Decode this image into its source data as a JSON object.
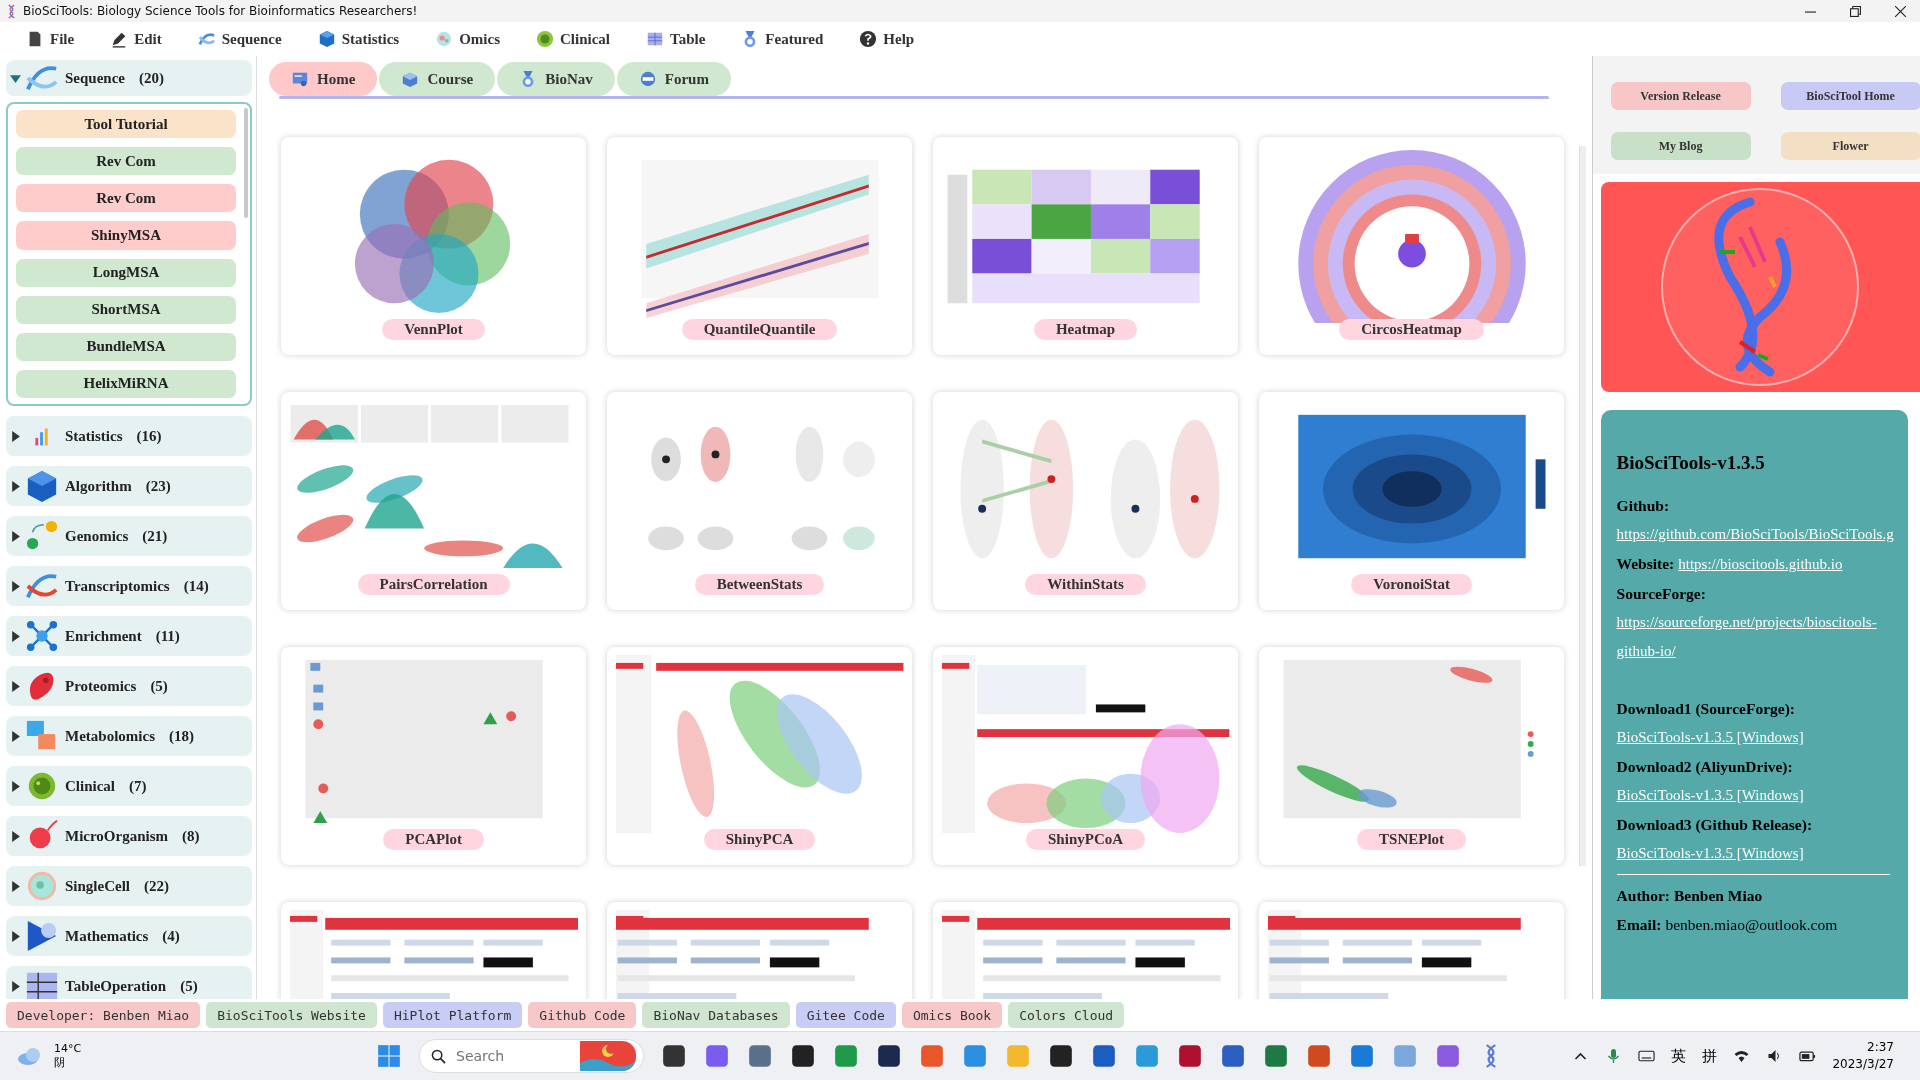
{
  "window": {
    "title": "BioSciTools: Biology Science Tools for Bioinformatics Researchers!"
  },
  "menu": [
    {
      "label": "File"
    },
    {
      "label": "Edit"
    },
    {
      "label": "Sequence"
    },
    {
      "label": "Statistics"
    },
    {
      "label": "Omics"
    },
    {
      "label": "Clinical"
    },
    {
      "label": "Table"
    },
    {
      "label": "Featured"
    },
    {
      "label": "Help"
    }
  ],
  "sidebar": {
    "groups": [
      {
        "label": "Sequence",
        "count": "(20)",
        "expanded": true,
        "items": [
          {
            "label": "Tool Tutorial",
            "color": "#fbe3c9"
          },
          {
            "label": "Rev Com",
            "color": "#cfe8cf"
          },
          {
            "label": "Rev Com",
            "color": "#ffcccc"
          },
          {
            "label": "ShinyMSA",
            "color": "#ffcccc"
          },
          {
            "label": "LongMSA",
            "color": "#cfe8cf"
          },
          {
            "label": "ShortMSA",
            "color": "#cfe8cf"
          },
          {
            "label": "BundleMSA",
            "color": "#cfe8cf"
          },
          {
            "label": "HelixMiRNA",
            "color": "#cfe8cf"
          }
        ]
      },
      {
        "label": "Statistics",
        "count": "(16)",
        "expanded": false
      },
      {
        "label": "Algorithm",
        "count": "(23)",
        "expanded": false
      },
      {
        "label": "Genomics",
        "count": "(21)",
        "expanded": false
      },
      {
        "label": "Transcriptomics",
        "count": "(14)",
        "expanded": false
      },
      {
        "label": "Enrichment",
        "count": "(11)",
        "expanded": false
      },
      {
        "label": "Proteomics",
        "count": "(5)",
        "expanded": false
      },
      {
        "label": "Metabolomics",
        "count": "(18)",
        "expanded": false
      },
      {
        "label": "Clinical",
        "count": "(7)",
        "expanded": false
      },
      {
        "label": "MicroOrganism",
        "count": "(8)",
        "expanded": false
      },
      {
        "label": "SingleCell",
        "count": "(22)",
        "expanded": false
      },
      {
        "label": "Mathematics",
        "count": "(4)",
        "expanded": false
      },
      {
        "label": "TableOperation",
        "count": "(5)",
        "expanded": false
      }
    ]
  },
  "tabs": [
    {
      "label": "Home",
      "selected": true
    },
    {
      "label": "Course",
      "selected": false
    },
    {
      "label": "BioNav",
      "selected": false
    },
    {
      "label": "Forum",
      "selected": false
    }
  ],
  "gallery": [
    {
      "kind": "picture",
      "label": "VennPlot"
    },
    {
      "kind": "picture",
      "label": "QuantileQuantile"
    },
    {
      "kind": "picture",
      "label": "Heatmap"
    },
    {
      "kind": "picture",
      "label": "CircosHeatmap"
    },
    {
      "kind": "picture",
      "label": "PairsCorrelation"
    },
    {
      "kind": "picture",
      "label": "BetweenStats"
    },
    {
      "kind": "picture",
      "label": "WithinStats"
    },
    {
      "kind": "picture",
      "label": "VoronoiStat"
    },
    {
      "kind": "picture",
      "label": "PCAPlot"
    },
    {
      "kind": "picture",
      "label": "ShinyPCA"
    },
    {
      "kind": "picture",
      "label": "ShinyPCoA"
    },
    {
      "kind": "picture",
      "label": "TSNEPlot"
    },
    {
      "kind": "picture"
    },
    {
      "kind": "picture"
    },
    {
      "kind": "picture"
    },
    {
      "kind": "picture"
    }
  ],
  "quick_links": [
    {
      "label": "Version Release",
      "color": "#f7c6c6"
    },
    {
      "label": "BioSciTool Home",
      "color": "#c9c9f5"
    },
    {
      "label": "My Blog",
      "color": "#c8e0c8"
    },
    {
      "label": "Flower",
      "color": "#f3dfc4"
    }
  ],
  "info": {
    "title": "BioSciTools-v1.3.5",
    "entries": [
      {
        "kind": "block_link",
        "label": "Github:",
        "value": "https://github.com/BioSciTools/BioSciTools.g"
      },
      {
        "kind": "inline_link",
        "label": "Website:",
        "value": "https://bioscitools.github.io"
      },
      {
        "kind": "block_link",
        "label": "SourceForge:",
        "value": "https://sourceforge.net/projects/bioscitools-github-io/"
      },
      {
        "kind": "gap"
      },
      {
        "kind": "block_link",
        "label": "Download1 (SourceForge):",
        "value": "BioSciTools-v1.3.5 [Windows]"
      },
      {
        "kind": "block_link",
        "label": "Download2 (AliyunDrive):",
        "value": "BioSciTools-v1.3.5 [Windows]"
      },
      {
        "kind": "block_link",
        "label": "Download3 (Github Release):",
        "value": "BioSciTools-v1.3.5 [Windows]"
      },
      {
        "kind": "rule"
      },
      {
        "kind": "bold",
        "label": "Author:",
        "value": "Benben Miao"
      },
      {
        "kind": "text",
        "label": "Email:",
        "value": "benben.miao@outlook.com"
      }
    ]
  },
  "footer_links": [
    {
      "label": "Developer: Benben Miao",
      "color": "#f8c8c8"
    },
    {
      "label": "BioSciTools Website",
      "color": "#cfe5cf"
    },
    {
      "label": "HiPlot Platform",
      "color": "#c9ccf5"
    },
    {
      "label": "Github Code",
      "color": "#f8c8c8"
    },
    {
      "label": "BioNav Databases",
      "color": "#cfe5cf"
    },
    {
      "label": "Gitee Code",
      "color": "#c9ccf5"
    },
    {
      "label": "Omics Book",
      "color": "#f8c8c8"
    },
    {
      "label": "Colors Cloud",
      "color": "#cfe5cf"
    }
  ],
  "taskbar": {
    "temperature": "14°C",
    "weather": "阴",
    "search": {
      "placeholder": "Search"
    },
    "input_modes": [
      "英",
      "拼"
    ],
    "time": "2:37",
    "date": "2023/3/27"
  }
}
